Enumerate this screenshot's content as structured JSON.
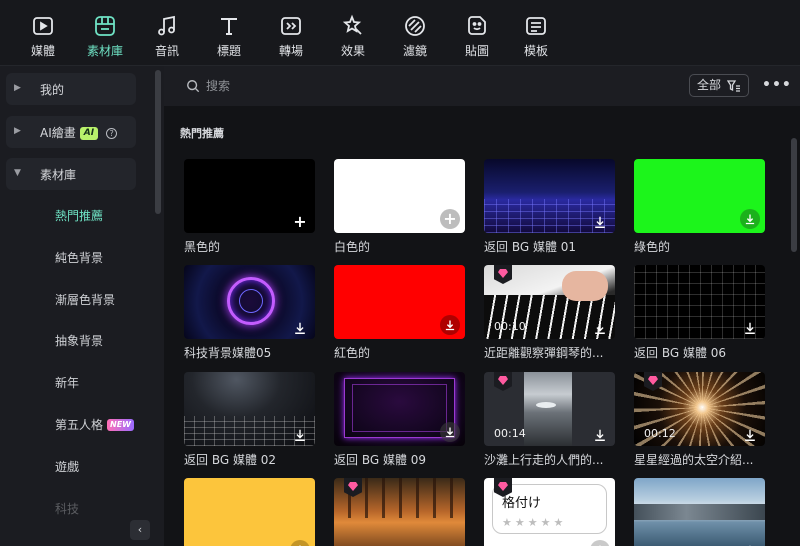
{
  "toolbar": {
    "items": [
      {
        "label": "媒體",
        "icon": "media-icon",
        "active": false
      },
      {
        "label": "素材庫",
        "icon": "stock-library-icon",
        "active": true
      },
      {
        "label": "音訊",
        "icon": "music-note-icon",
        "active": false
      },
      {
        "label": "標題",
        "icon": "title-text-icon",
        "active": false
      },
      {
        "label": "轉場",
        "icon": "transition-icon",
        "active": false
      },
      {
        "label": "效果",
        "icon": "effects-star-icon",
        "active": false
      },
      {
        "label": "濾鏡",
        "icon": "filter-icon",
        "active": false
      },
      {
        "label": "貼圖",
        "icon": "sticker-icon",
        "active": false
      },
      {
        "label": "模板",
        "icon": "template-icon",
        "active": false
      }
    ],
    "accent": "#6fe3c5"
  },
  "sidebar": {
    "groups": [
      {
        "label": "我的",
        "expanded": false
      },
      {
        "label": "AI繪畫",
        "badge": "AI",
        "expanded": false
      },
      {
        "label": "素材庫",
        "expanded": true
      }
    ],
    "sub_items": [
      {
        "label": "熱門推薦",
        "active": true
      },
      {
        "label": "純色背景"
      },
      {
        "label": "漸層色背景"
      },
      {
        "label": "抽象背景"
      },
      {
        "label": "新年"
      },
      {
        "label": "第五人格",
        "badge": "NEW"
      },
      {
        "label": "遊戲"
      },
      {
        "label": "科技"
      }
    ],
    "collapse_icon": "‹"
  },
  "search": {
    "placeholder": "搜索",
    "filter_label": "全部",
    "more_label": "•••"
  },
  "section": {
    "title": "熱門推薦"
  },
  "assets": [
    {
      "name": "黑色的",
      "action": "add"
    },
    {
      "name": "白色的",
      "action": "add"
    },
    {
      "name": "返回 BG 媒體 01",
      "action": "download"
    },
    {
      "name": "綠色的",
      "action": "download"
    },
    {
      "name": "科技背景媒體05",
      "action": "download"
    },
    {
      "name": "紅色的",
      "action": "download"
    },
    {
      "name": "近距離觀察彈鋼琴的...",
      "action": "download",
      "premium": true,
      "duration": "00:10"
    },
    {
      "name": "返回 BG 媒體 06",
      "action": "download"
    },
    {
      "name": "返回 BG 媒體 02",
      "action": "download"
    },
    {
      "name": "返回 BG 媒體 09",
      "action": "download"
    },
    {
      "name": "沙灘上行走的人們的...",
      "action": "download",
      "premium": true,
      "duration": "00:14"
    },
    {
      "name": "星星經過的太空介紹...",
      "action": "download",
      "premium": true,
      "duration": "00:12"
    },
    {
      "name": "",
      "action": "download"
    },
    {
      "name": "",
      "action": "download",
      "premium": true
    },
    {
      "name": "",
      "action": "download",
      "premium": true,
      "overlay_text": "格付け"
    },
    {
      "name": "",
      "action": "add"
    }
  ]
}
